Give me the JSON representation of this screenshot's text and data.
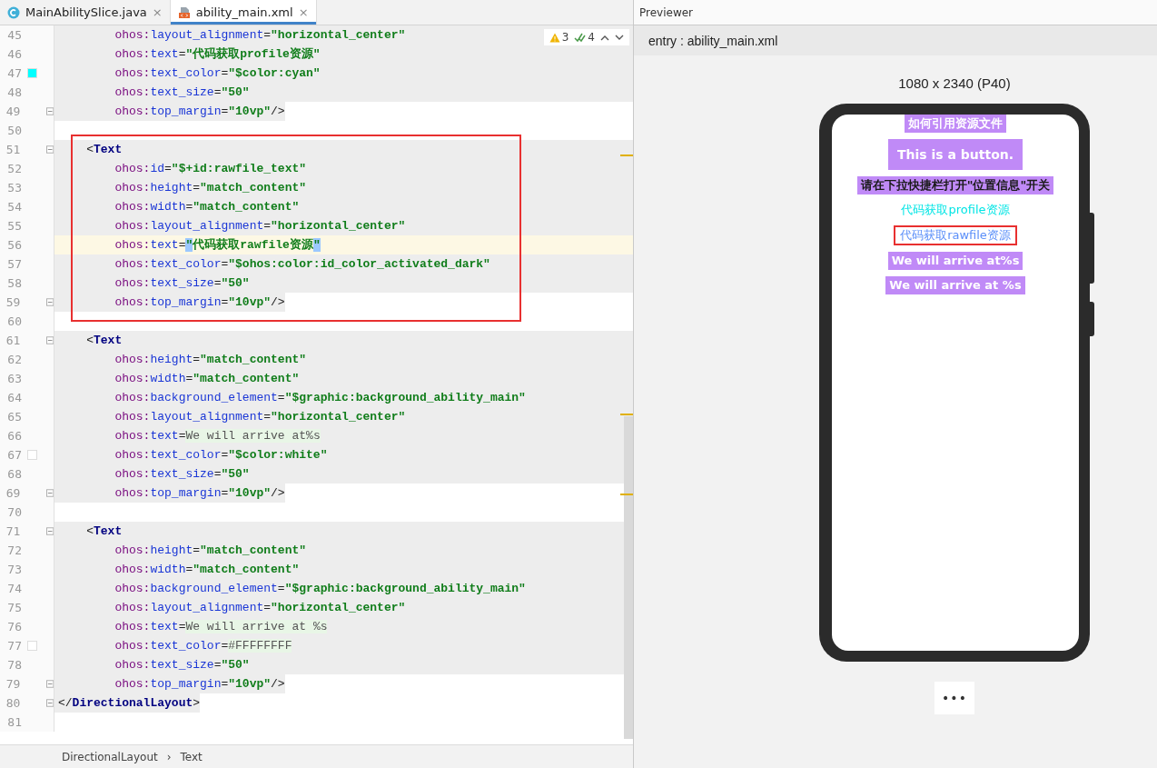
{
  "editor": {
    "tabs": [
      {
        "label": "MainAbilitySlice.java",
        "kind": "java",
        "selected": false,
        "close": "×"
      },
      {
        "label": "ability_main.xml",
        "kind": "xml",
        "selected": true,
        "close": "×"
      }
    ],
    "inspections": {
      "warnings": "3",
      "checks": "4"
    },
    "sections": [
      {
        "boxed": false,
        "lines": [
          {
            "num": "45",
            "kind": "block",
            "fold": false,
            "t": [
              {
                "kind": "ns",
                "text": "        ohos:"
              },
              {
                "kind": "attr",
                "text": "layout_alignment"
              },
              {
                "kind": "eq",
                "text": "="
              },
              {
                "kind": "str",
                "text": "\"horizontal_center\""
              }
            ]
          },
          {
            "num": "46",
            "kind": "block",
            "fold": false,
            "t": [
              {
                "kind": "ns",
                "text": "        ohos:"
              },
              {
                "kind": "attr",
                "text": "text"
              },
              {
                "kind": "eq",
                "text": "="
              },
              {
                "kind": "str",
                "text": "\"代码获取profile资源\""
              }
            ]
          },
          {
            "num": "47",
            "kind": "block",
            "fold": false,
            "color": "#00ffff",
            "t": [
              {
                "kind": "ns",
                "text": "        ohos:"
              },
              {
                "kind": "attr",
                "text": "text_color"
              },
              {
                "kind": "eq",
                "text": "="
              },
              {
                "kind": "str",
                "text": "\"$color:cyan\""
              }
            ]
          },
          {
            "num": "48",
            "kind": "block",
            "fold": false,
            "t": [
              {
                "kind": "ns",
                "text": "        ohos:"
              },
              {
                "kind": "attr",
                "text": "text_size"
              },
              {
                "kind": "eq",
                "text": "="
              },
              {
                "kind": "str",
                "text": "\"50\""
              }
            ]
          },
          {
            "num": "49",
            "kind": "tail",
            "fold": true,
            "t": [
              {
                "kind": "ns",
                "text": "        ohos:"
              },
              {
                "kind": "attr",
                "text": "top_margin"
              },
              {
                "kind": "eq",
                "text": "="
              },
              {
                "kind": "str",
                "text": "\"10vp\""
              },
              {
                "kind": "eq",
                "text": "/>"
              }
            ]
          },
          {
            "num": "50",
            "kind": "plain",
            "fold": false
          }
        ]
      },
      {
        "boxed": true,
        "lines": [
          {
            "num": "51",
            "kind": "block",
            "fold": true,
            "t": [
              {
                "kind": "eq",
                "text": "    <"
              },
              {
                "kind": "tag",
                "text": "Text"
              }
            ]
          },
          {
            "num": "52",
            "kind": "block",
            "fold": false,
            "t": [
              {
                "kind": "ns",
                "text": "        ohos:"
              },
              {
                "kind": "attr",
                "text": "id"
              },
              {
                "kind": "eq",
                "text": "="
              },
              {
                "kind": "str",
                "text": "\"$+id:rawfile_text\""
              }
            ]
          },
          {
            "num": "53",
            "kind": "block",
            "fold": false,
            "t": [
              {
                "kind": "ns",
                "text": "        ohos:"
              },
              {
                "kind": "attr",
                "text": "height"
              },
              {
                "kind": "eq",
                "text": "="
              },
              {
                "kind": "str",
                "text": "\"match_content\""
              }
            ]
          },
          {
            "num": "54",
            "kind": "block",
            "fold": false,
            "t": [
              {
                "kind": "ns",
                "text": "        ohos:"
              },
              {
                "kind": "attr",
                "text": "width"
              },
              {
                "kind": "eq",
                "text": "="
              },
              {
                "kind": "str",
                "text": "\"match_content\""
              }
            ]
          },
          {
            "num": "55",
            "kind": "block",
            "fold": false,
            "t": [
              {
                "kind": "ns",
                "text": "        ohos:"
              },
              {
                "kind": "attr",
                "text": "layout_alignment"
              },
              {
                "kind": "eq",
                "text": "="
              },
              {
                "kind": "str",
                "text": "\"horizontal_center\""
              }
            ]
          },
          {
            "num": "56",
            "kind": "current",
            "fold": false,
            "t": [
              {
                "kind": "ns",
                "text": "        ohos:"
              },
              {
                "kind": "attr",
                "text": "text"
              },
              {
                "kind": "eq",
                "text": "="
              },
              {
                "kind": "sel",
                "text": "\""
              },
              {
                "kind": "str",
                "text": "代码获取rawfile资源"
              },
              {
                "kind": "sel",
                "text": "\""
              }
            ]
          },
          {
            "num": "57",
            "kind": "block",
            "fold": false,
            "t": [
              {
                "kind": "ns",
                "text": "        ohos:"
              },
              {
                "kind": "attr",
                "text": "text_color"
              },
              {
                "kind": "eq",
                "text": "="
              },
              {
                "kind": "str",
                "text": "\"$ohos:color:id_color_activated_dark\""
              }
            ]
          },
          {
            "num": "58",
            "kind": "block",
            "fold": false,
            "t": [
              {
                "kind": "ns",
                "text": "        ohos:"
              },
              {
                "kind": "attr",
                "text": "text_size"
              },
              {
                "kind": "eq",
                "text": "="
              },
              {
                "kind": "str",
                "text": "\"50\""
              }
            ]
          },
          {
            "num": "59",
            "kind": "tail",
            "fold": true,
            "t": [
              {
                "kind": "ns",
                "text": "        ohos:"
              },
              {
                "kind": "attr",
                "text": "top_margin"
              },
              {
                "kind": "eq",
                "text": "="
              },
              {
                "kind": "str",
                "text": "\"10vp\""
              },
              {
                "kind": "eq",
                "text": "/>"
              }
            ]
          }
        ]
      },
      {
        "boxed": false,
        "lines": [
          {
            "num": "60",
            "kind": "plain",
            "fold": false
          },
          {
            "num": "61",
            "kind": "block",
            "fold": true,
            "t": [
              {
                "kind": "eq",
                "text": "    <"
              },
              {
                "kind": "tag",
                "text": "Text"
              }
            ]
          },
          {
            "num": "62",
            "kind": "block",
            "fold": false,
            "t": [
              {
                "kind": "ns",
                "text": "        ohos:"
              },
              {
                "kind": "attr",
                "text": "height"
              },
              {
                "kind": "eq",
                "text": "="
              },
              {
                "kind": "str",
                "text": "\"match_content\""
              }
            ]
          },
          {
            "num": "63",
            "kind": "block",
            "fold": false,
            "t": [
              {
                "kind": "ns",
                "text": "        ohos:"
              },
              {
                "kind": "attr",
                "text": "width"
              },
              {
                "kind": "eq",
                "text": "="
              },
              {
                "kind": "str",
                "text": "\"match_content\""
              }
            ]
          },
          {
            "num": "64",
            "kind": "block",
            "fold": false,
            "t": [
              {
                "kind": "ns",
                "text": "        ohos:"
              },
              {
                "kind": "attr",
                "text": "background_element"
              },
              {
                "kind": "eq",
                "text": "="
              },
              {
                "kind": "str",
                "text": "\"$graphic:background_ability_main\""
              }
            ]
          },
          {
            "num": "65",
            "kind": "block",
            "fold": false,
            "t": [
              {
                "kind": "ns",
                "text": "        ohos:"
              },
              {
                "kind": "attr",
                "text": "layout_alignment"
              },
              {
                "kind": "eq",
                "text": "="
              },
              {
                "kind": "str",
                "text": "\"horizontal_center\""
              }
            ]
          },
          {
            "num": "66",
            "kind": "block",
            "fold": false,
            "t": [
              {
                "kind": "ns",
                "text": "        ohos:"
              },
              {
                "kind": "attr",
                "text": "text"
              },
              {
                "kind": "eq",
                "text": "="
              },
              {
                "kind": "lit",
                "text": "We will arrive at%s"
              }
            ]
          },
          {
            "num": "67",
            "kind": "block",
            "fold": false,
            "color": "#ffffff",
            "t": [
              {
                "kind": "ns",
                "text": "        ohos:"
              },
              {
                "kind": "attr",
                "text": "text_color"
              },
              {
                "kind": "eq",
                "text": "="
              },
              {
                "kind": "str",
                "text": "\"$color:white\""
              }
            ]
          },
          {
            "num": "68",
            "kind": "block",
            "fold": false,
            "t": [
              {
                "kind": "ns",
                "text": "        ohos:"
              },
              {
                "kind": "attr",
                "text": "text_size"
              },
              {
                "kind": "eq",
                "text": "="
              },
              {
                "kind": "str",
                "text": "\"50\""
              }
            ]
          },
          {
            "num": "69",
            "kind": "tail",
            "fold": true,
            "t": [
              {
                "kind": "ns",
                "text": "        ohos:"
              },
              {
                "kind": "attr",
                "text": "top_margin"
              },
              {
                "kind": "eq",
                "text": "="
              },
              {
                "kind": "str",
                "text": "\"10vp\""
              },
              {
                "kind": "eq",
                "text": "/>"
              }
            ]
          },
          {
            "num": "70",
            "kind": "plain",
            "fold": false
          },
          {
            "num": "71",
            "kind": "block",
            "fold": true,
            "t": [
              {
                "kind": "eq",
                "text": "    <"
              },
              {
                "kind": "tag",
                "text": "Text"
              }
            ]
          },
          {
            "num": "72",
            "kind": "block",
            "fold": false,
            "t": [
              {
                "kind": "ns",
                "text": "        ohos:"
              },
              {
                "kind": "attr",
                "text": "height"
              },
              {
                "kind": "eq",
                "text": "="
              },
              {
                "kind": "str",
                "text": "\"match_content\""
              }
            ]
          },
          {
            "num": "73",
            "kind": "block",
            "fold": false,
            "t": [
              {
                "kind": "ns",
                "text": "        ohos:"
              },
              {
                "kind": "attr",
                "text": "width"
              },
              {
                "kind": "eq",
                "text": "="
              },
              {
                "kind": "str",
                "text": "\"match_content\""
              }
            ]
          },
          {
            "num": "74",
            "kind": "block",
            "fold": false,
            "t": [
              {
                "kind": "ns",
                "text": "        ohos:"
              },
              {
                "kind": "attr",
                "text": "background_element"
              },
              {
                "kind": "eq",
                "text": "="
              },
              {
                "kind": "str",
                "text": "\"$graphic:background_ability_main\""
              }
            ]
          },
          {
            "num": "75",
            "kind": "block",
            "fold": false,
            "t": [
              {
                "kind": "ns",
                "text": "        ohos:"
              },
              {
                "kind": "attr",
                "text": "layout_alignment"
              },
              {
                "kind": "eq",
                "text": "="
              },
              {
                "kind": "str",
                "text": "\"horizontal_center\""
              }
            ]
          },
          {
            "num": "76",
            "kind": "block",
            "fold": false,
            "t": [
              {
                "kind": "ns",
                "text": "        ohos:"
              },
              {
                "kind": "attr",
                "text": "text"
              },
              {
                "kind": "eq",
                "text": "="
              },
              {
                "kind": "lit",
                "text": "We will arrive at %s"
              }
            ]
          },
          {
            "num": "77",
            "kind": "block",
            "fold": false,
            "color": "#ffffff",
            "t": [
              {
                "kind": "ns",
                "text": "        ohos:"
              },
              {
                "kind": "attr",
                "text": "text_color"
              },
              {
                "kind": "eq",
                "text": "="
              },
              {
                "kind": "lit",
                "text": "#FFFFFFFF"
              }
            ]
          },
          {
            "num": "78",
            "kind": "block",
            "fold": false,
            "t": [
              {
                "kind": "ns",
                "text": "        ohos:"
              },
              {
                "kind": "attr",
                "text": "text_size"
              },
              {
                "kind": "eq",
                "text": "="
              },
              {
                "kind": "str",
                "text": "\"50\""
              }
            ]
          },
          {
            "num": "79",
            "kind": "tail",
            "fold": true,
            "t": [
              {
                "kind": "ns",
                "text": "        ohos:"
              },
              {
                "kind": "attr",
                "text": "top_margin"
              },
              {
                "kind": "eq",
                "text": "="
              },
              {
                "kind": "str",
                "text": "\"10vp\""
              },
              {
                "kind": "eq",
                "text": "/>"
              }
            ]
          },
          {
            "num": "80",
            "kind": "tail",
            "fold": true,
            "t": [
              {
                "kind": "eq",
                "text": "</"
              },
              {
                "kind": "tag",
                "text": "DirectionalLayout"
              },
              {
                "kind": "eq",
                "text": ">"
              }
            ]
          },
          {
            "num": "81",
            "kind": "plain",
            "fold": false
          }
        ]
      }
    ],
    "breadcrumb": [
      "DirectionalLayout",
      "›",
      "Text"
    ]
  },
  "previewer": {
    "title": "Previewer",
    "entry": "entry : ability_main.xml",
    "device": "1080 x 2340 (P40)",
    "screen": [
      {
        "text": "如何引用资源文件",
        "kind": "label",
        "color": "#ffffff",
        "background": true,
        "boxed": false
      },
      {
        "text": "This is a button.",
        "kind": "button",
        "color": "#ffffff",
        "background": true,
        "boxed": false
      },
      {
        "text": "请在下拉快捷栏打开\"位置信息\"开关",
        "kind": "label",
        "color": "#1a1a1a",
        "background": true,
        "boxed": false
      },
      {
        "text": "代码获取profile资源",
        "kind": "label",
        "color": "#00e5e5",
        "background": false,
        "boxed": false
      },
      {
        "text": "代码获取rawfile资源",
        "kind": "label",
        "color": "#5b8ff9",
        "background": false,
        "boxed": true
      },
      {
        "text": "We will arrive at%s",
        "kind": "label",
        "color": "#ffffff",
        "background": true,
        "boxed": false
      },
      {
        "text": "We will arrive at %s",
        "kind": "label",
        "color": "#ffffff",
        "background": true,
        "boxed": false
      }
    ],
    "more": "•••"
  }
}
